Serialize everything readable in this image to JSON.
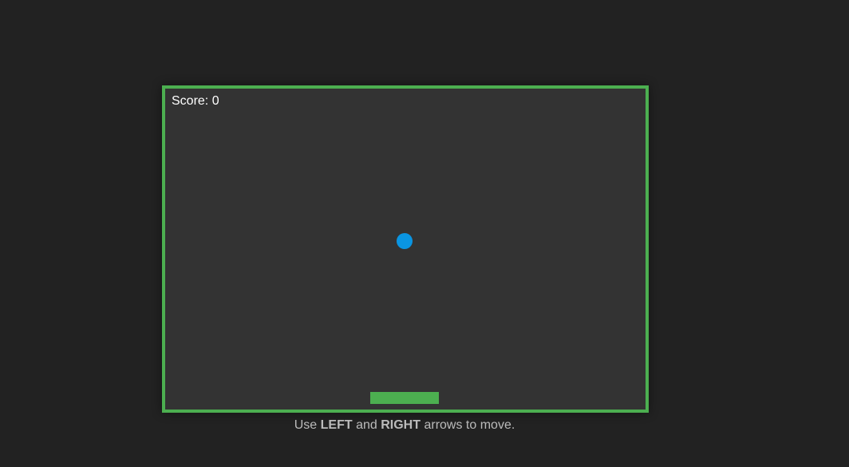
{
  "game": {
    "score_label": "Score:",
    "score_value": "0"
  },
  "instructions": {
    "prefix": "Use",
    "key_left": "LEFT",
    "conjunction": "and",
    "key_right": "RIGHT",
    "suffix": "arrows to move."
  },
  "colors": {
    "page_background": "#222222",
    "board_background": "#333333",
    "board_border": "#4caf50",
    "paddle": "#4caf50",
    "ball": "#0a95e2",
    "score_text": "#ffffff",
    "instruction_text": "#bbbbbb"
  }
}
